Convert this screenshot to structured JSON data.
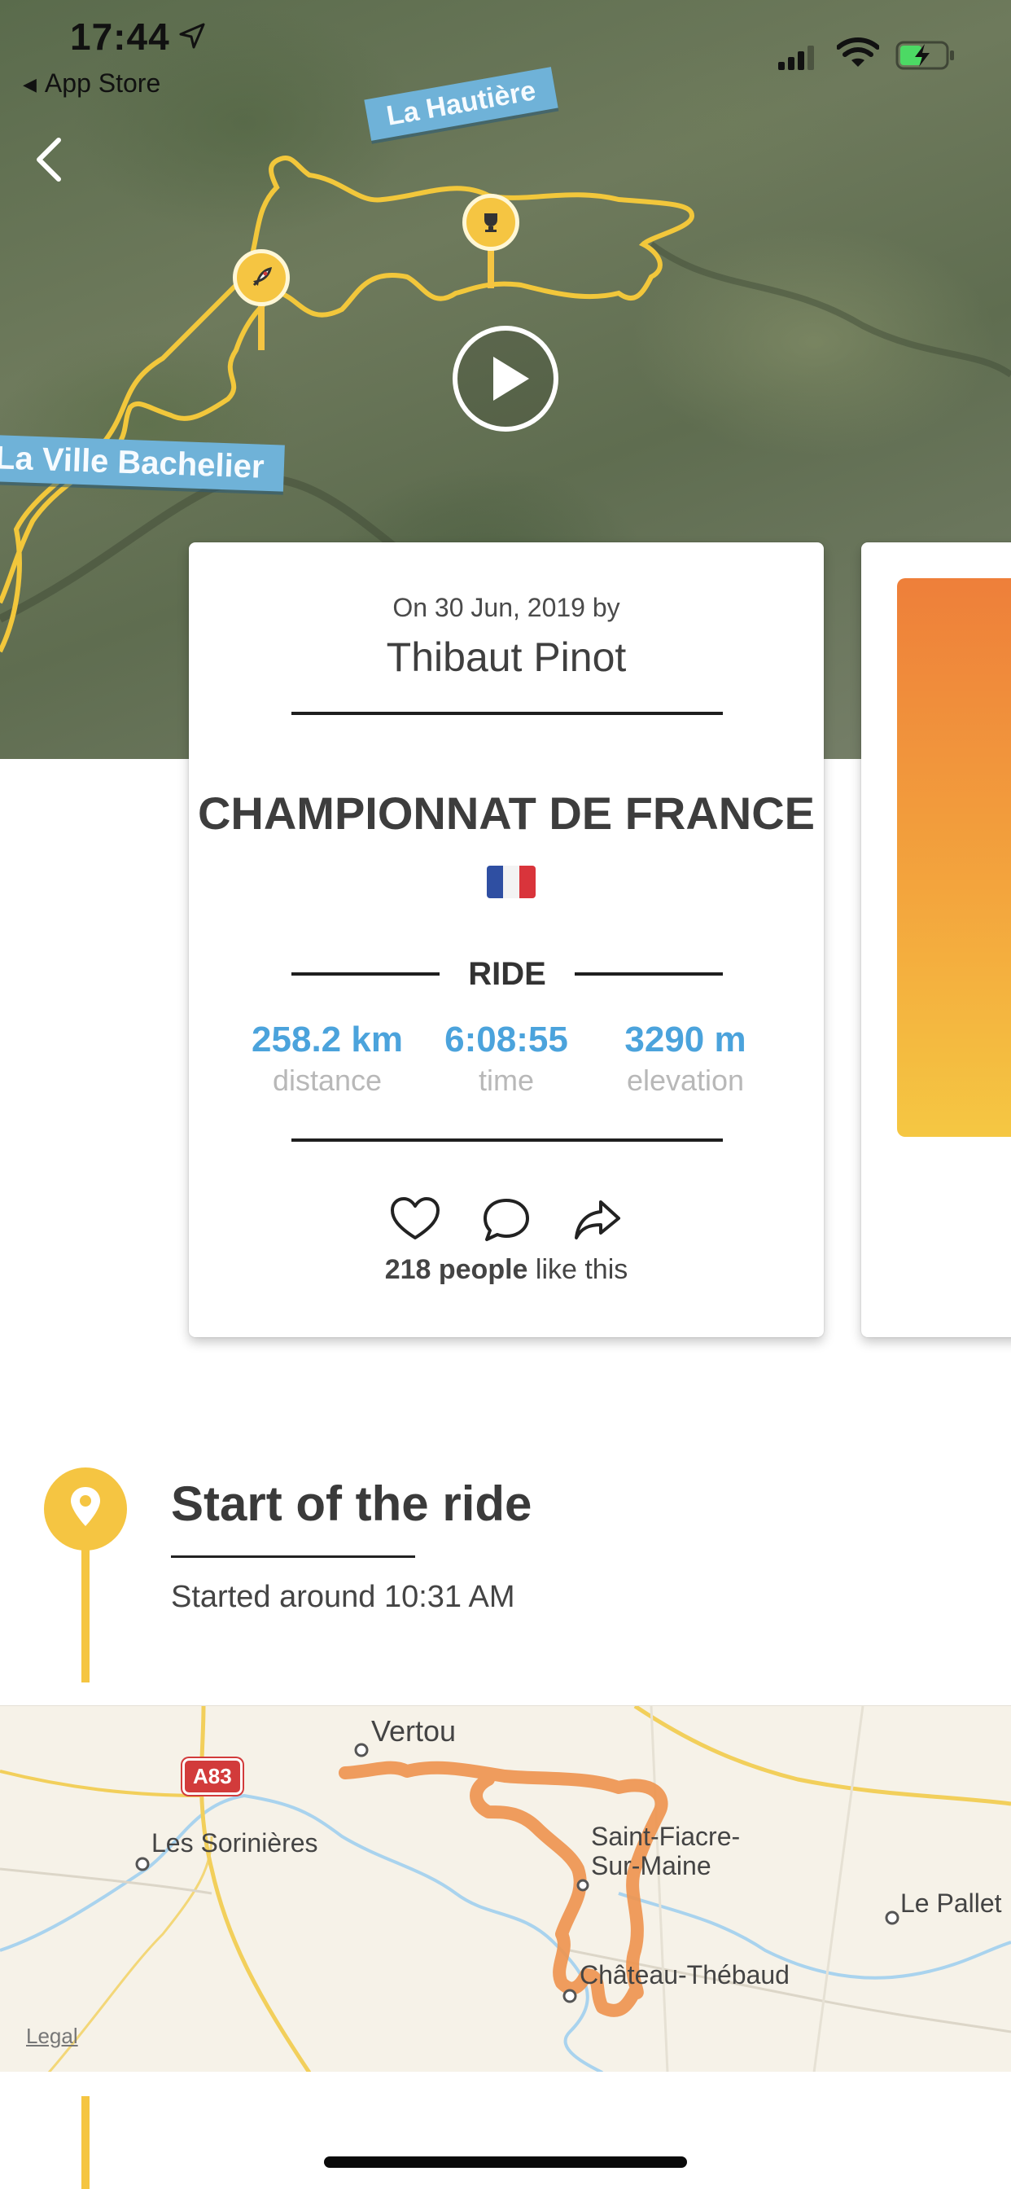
{
  "status_bar": {
    "time": "17:44",
    "back_app_label": "App Store"
  },
  "hero": {
    "labels": [
      "La Hautière",
      "La Ville Bachelier"
    ],
    "icons": [
      "chevron-left-icon",
      "play-icon",
      "rocket-icon",
      "trophy-icon"
    ],
    "colors": {
      "route": "#f2c73b",
      "label_bg": "#6fb2d8"
    }
  },
  "card": {
    "date_by": "On 30 Jun, 2019 by",
    "rider": "Thibaut Pinot",
    "title": "CHAMPIONNAT DE FRANCE",
    "flag": "🇫🇷",
    "type_label": "RIDE",
    "stats": [
      {
        "value": "258.2 km",
        "label": "distance"
      },
      {
        "value": "6:08:55",
        "label": "time"
      },
      {
        "value": "3290 m",
        "label": "elevation"
      }
    ],
    "likes_count": "218 people",
    "likes_suffix": " like this",
    "colors": {
      "stat_value": "#4ba3dc",
      "stat_label": "#b8b8b8"
    }
  },
  "timeline": {
    "section_title": "Start of the ride",
    "section_sub": "Started around 10:31 AM",
    "accent": "#f5c542"
  },
  "map": {
    "places": [
      "Vertou",
      "Les Sorinières",
      "Saint-Fiacre-",
      "Sur-Maine",
      "Le Pallet",
      "Château-Thébaud"
    ],
    "road_badge": "A83",
    "legal": "Legal",
    "route_color": "#ee9550"
  }
}
